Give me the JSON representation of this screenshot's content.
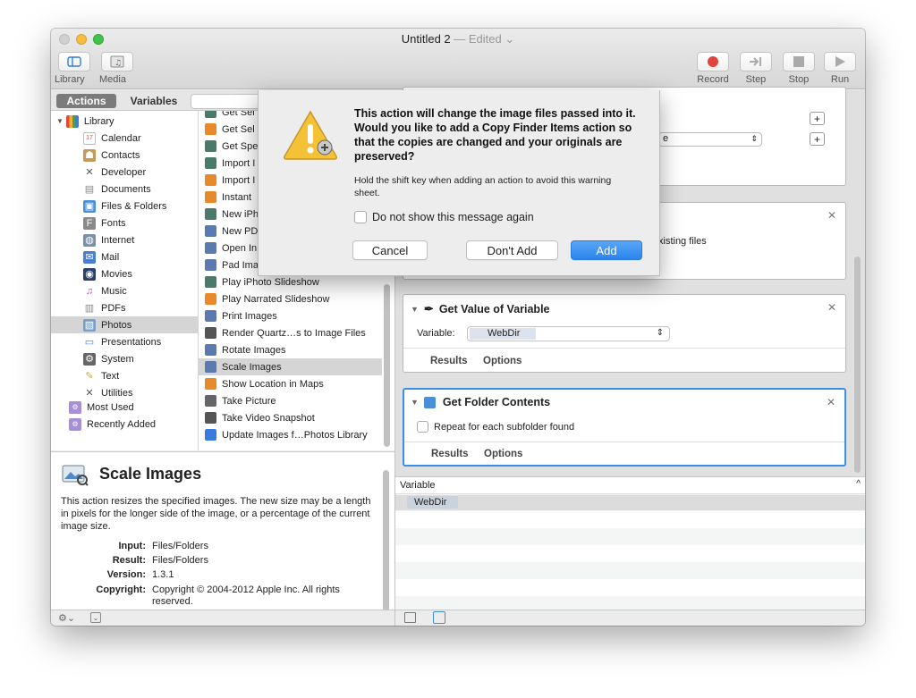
{
  "window": {
    "title": "Untitled 2",
    "subtitle": "— Edited",
    "dropdown_glyph": "⌄"
  },
  "toolbar": {
    "left": [
      {
        "label": "Library",
        "icon": "library-icon"
      },
      {
        "label": "Media",
        "icon": "media-icon"
      }
    ],
    "right": [
      {
        "label": "Record",
        "icon": "record-icon"
      },
      {
        "label": "Step",
        "icon": "step-icon"
      },
      {
        "label": "Stop",
        "icon": "stop-icon"
      },
      {
        "label": "Run",
        "icon": "run-icon"
      }
    ]
  },
  "tabs": {
    "actions": "Actions",
    "variables": "Variables"
  },
  "library": {
    "root": "Library",
    "items": [
      "Calendar",
      "Contacts",
      "Developer",
      "Documents",
      "Files & Folders",
      "Fonts",
      "Internet",
      "Mail",
      "Movies",
      "Music",
      "PDFs",
      "Photos",
      "Presentations",
      "System",
      "Text",
      "Utilities"
    ],
    "selected": "Photos",
    "smart": [
      "Most Used",
      "Recently Added"
    ]
  },
  "actions": {
    "items": [
      "Get Sel",
      "Get Sel",
      "Get Spe",
      "Import I",
      "Import I",
      "Instant",
      "New iPh",
      "New PD",
      "Open In",
      "Pad Ima",
      "Play iPhoto Slideshow",
      "Play Narrated Slideshow",
      "Print Images",
      "Render Quartz…s to Image Files",
      "Rotate Images",
      "Scale Images",
      "Show Location in Maps",
      "Take Picture",
      "Take Video Snapshot",
      "Update Images f…Photos Library"
    ],
    "selected": "Scale Images"
  },
  "description": {
    "title": "Scale Images",
    "body": "This action resizes the specified images. The new size may be a length in pixels for the longer side of the image, or a percentage of the current image size.",
    "input_label": "Input:",
    "input": "Files/Folders",
    "result_label": "Result:",
    "result": "Files/Folders",
    "version_label": "Version:",
    "version": "1.3.1",
    "copyright_label": "Copyright:",
    "copyright": "Copyright © 2004-2012 Apple Inc.  All rights reserved."
  },
  "workflow": {
    "card1": {
      "partial_text": "e"
    },
    "card2": {
      "partial_text": "xisting files"
    },
    "get_value": {
      "title": "Get Value of Variable",
      "variable_label": "Variable:",
      "variable_value": "WebDir",
      "results": "Results",
      "options": "Options"
    },
    "get_folder": {
      "title": "Get Folder Contents",
      "checkbox_label": "Repeat for each subfolder found",
      "results": "Results",
      "options": "Options"
    }
  },
  "variables_panel": {
    "header": "Variable",
    "rows": [
      "WebDir"
    ]
  },
  "dialog": {
    "heading": "This action will change the image files passed into it.  Would you like to add a Copy Finder Items action so that the copies are changed and your originals are preserved?",
    "hint": "Hold the shift key when adding an action to avoid this warning sheet.",
    "checkbox_label": "Do not show this message again",
    "cancel": "Cancel",
    "dont_add": "Don't Add",
    "add": "Add"
  },
  "colors": {
    "accent": "#3a8ee6",
    "selection": "#d5d5d5",
    "record": "#e0443e"
  }
}
